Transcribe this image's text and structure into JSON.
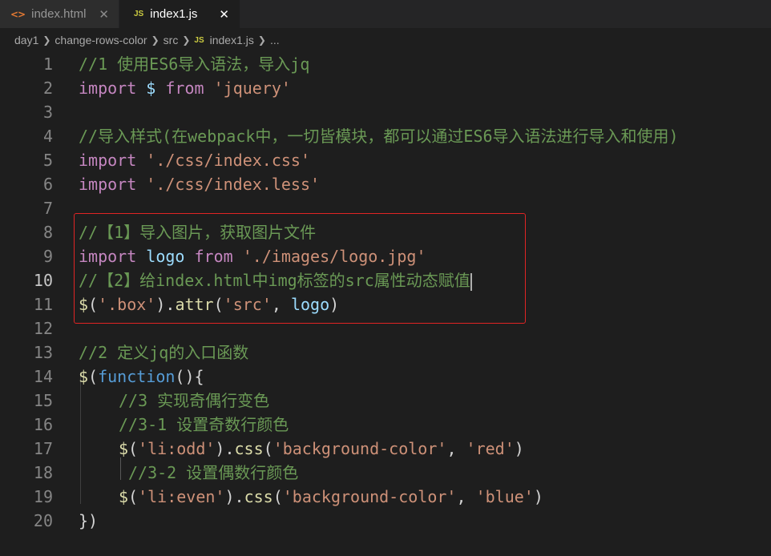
{
  "tabs": [
    {
      "icon": "html-icon",
      "icon_text": "<>",
      "label": "index.html",
      "close": "✕"
    },
    {
      "icon": "js-icon",
      "icon_text": "JS",
      "label": "index1.js",
      "close": "✕"
    }
  ],
  "breadcrumb": {
    "items": [
      "day1",
      "change-rows-color",
      "src"
    ],
    "file_icon_text": "JS",
    "file": "index1.js",
    "tail": "..."
  },
  "colors": {
    "keyword": "#c586c0",
    "function": "#dcdcaa",
    "string": "#ce9178",
    "comment": "#6a9955",
    "variable": "#9cdcfe",
    "highlight_border": "#e02424"
  },
  "current_line": "10",
  "line_numbers": [
    "1",
    "2",
    "3",
    "4",
    "5",
    "6",
    "7",
    "8",
    "9",
    "10",
    "11",
    "12",
    "13",
    "14",
    "15",
    "16",
    "17",
    "18",
    "19",
    "20"
  ],
  "code": {
    "l1": "//1 使用ES6导入语法，导入jq",
    "l2": [
      "import",
      "$",
      "from",
      "'jquery'"
    ],
    "l4": "//导入样式(在webpack中，一切皆模块，都可以通过ES6导入语法进行导入和使用)",
    "l5": [
      "import",
      "'./css/index.css'"
    ],
    "l6": [
      "import",
      "'./css/index.less'"
    ],
    "l8": "//【1】导入图片，获取图片文件",
    "l9": [
      "import",
      "logo",
      "from",
      "'./images/logo.jpg'"
    ],
    "l10": "//【2】给index.html中img标签的src属性动态赋值",
    "l11": [
      "$",
      "(",
      "'.box'",
      ").",
      "attr",
      "(",
      "'src'",
      ", ",
      "logo",
      ")"
    ],
    "l13": "//2 定义jq的入口函数",
    "l14": [
      "$",
      "(",
      "function",
      "(){"
    ],
    "l15": "//3 实现奇偶行变色",
    "l16": "//3-1 设置奇数行颜色",
    "l17": [
      "$",
      "(",
      "'li:odd'",
      ").",
      "css",
      "(",
      "'background-color'",
      ", ",
      "'red'",
      ")"
    ],
    "l18": "//3-2 设置偶数行颜色",
    "l19": [
      "$",
      "(",
      "'li:even'",
      ").",
      "css",
      "(",
      "'background-color'",
      ", ",
      "'blue'",
      ")"
    ],
    "l20": "})"
  }
}
